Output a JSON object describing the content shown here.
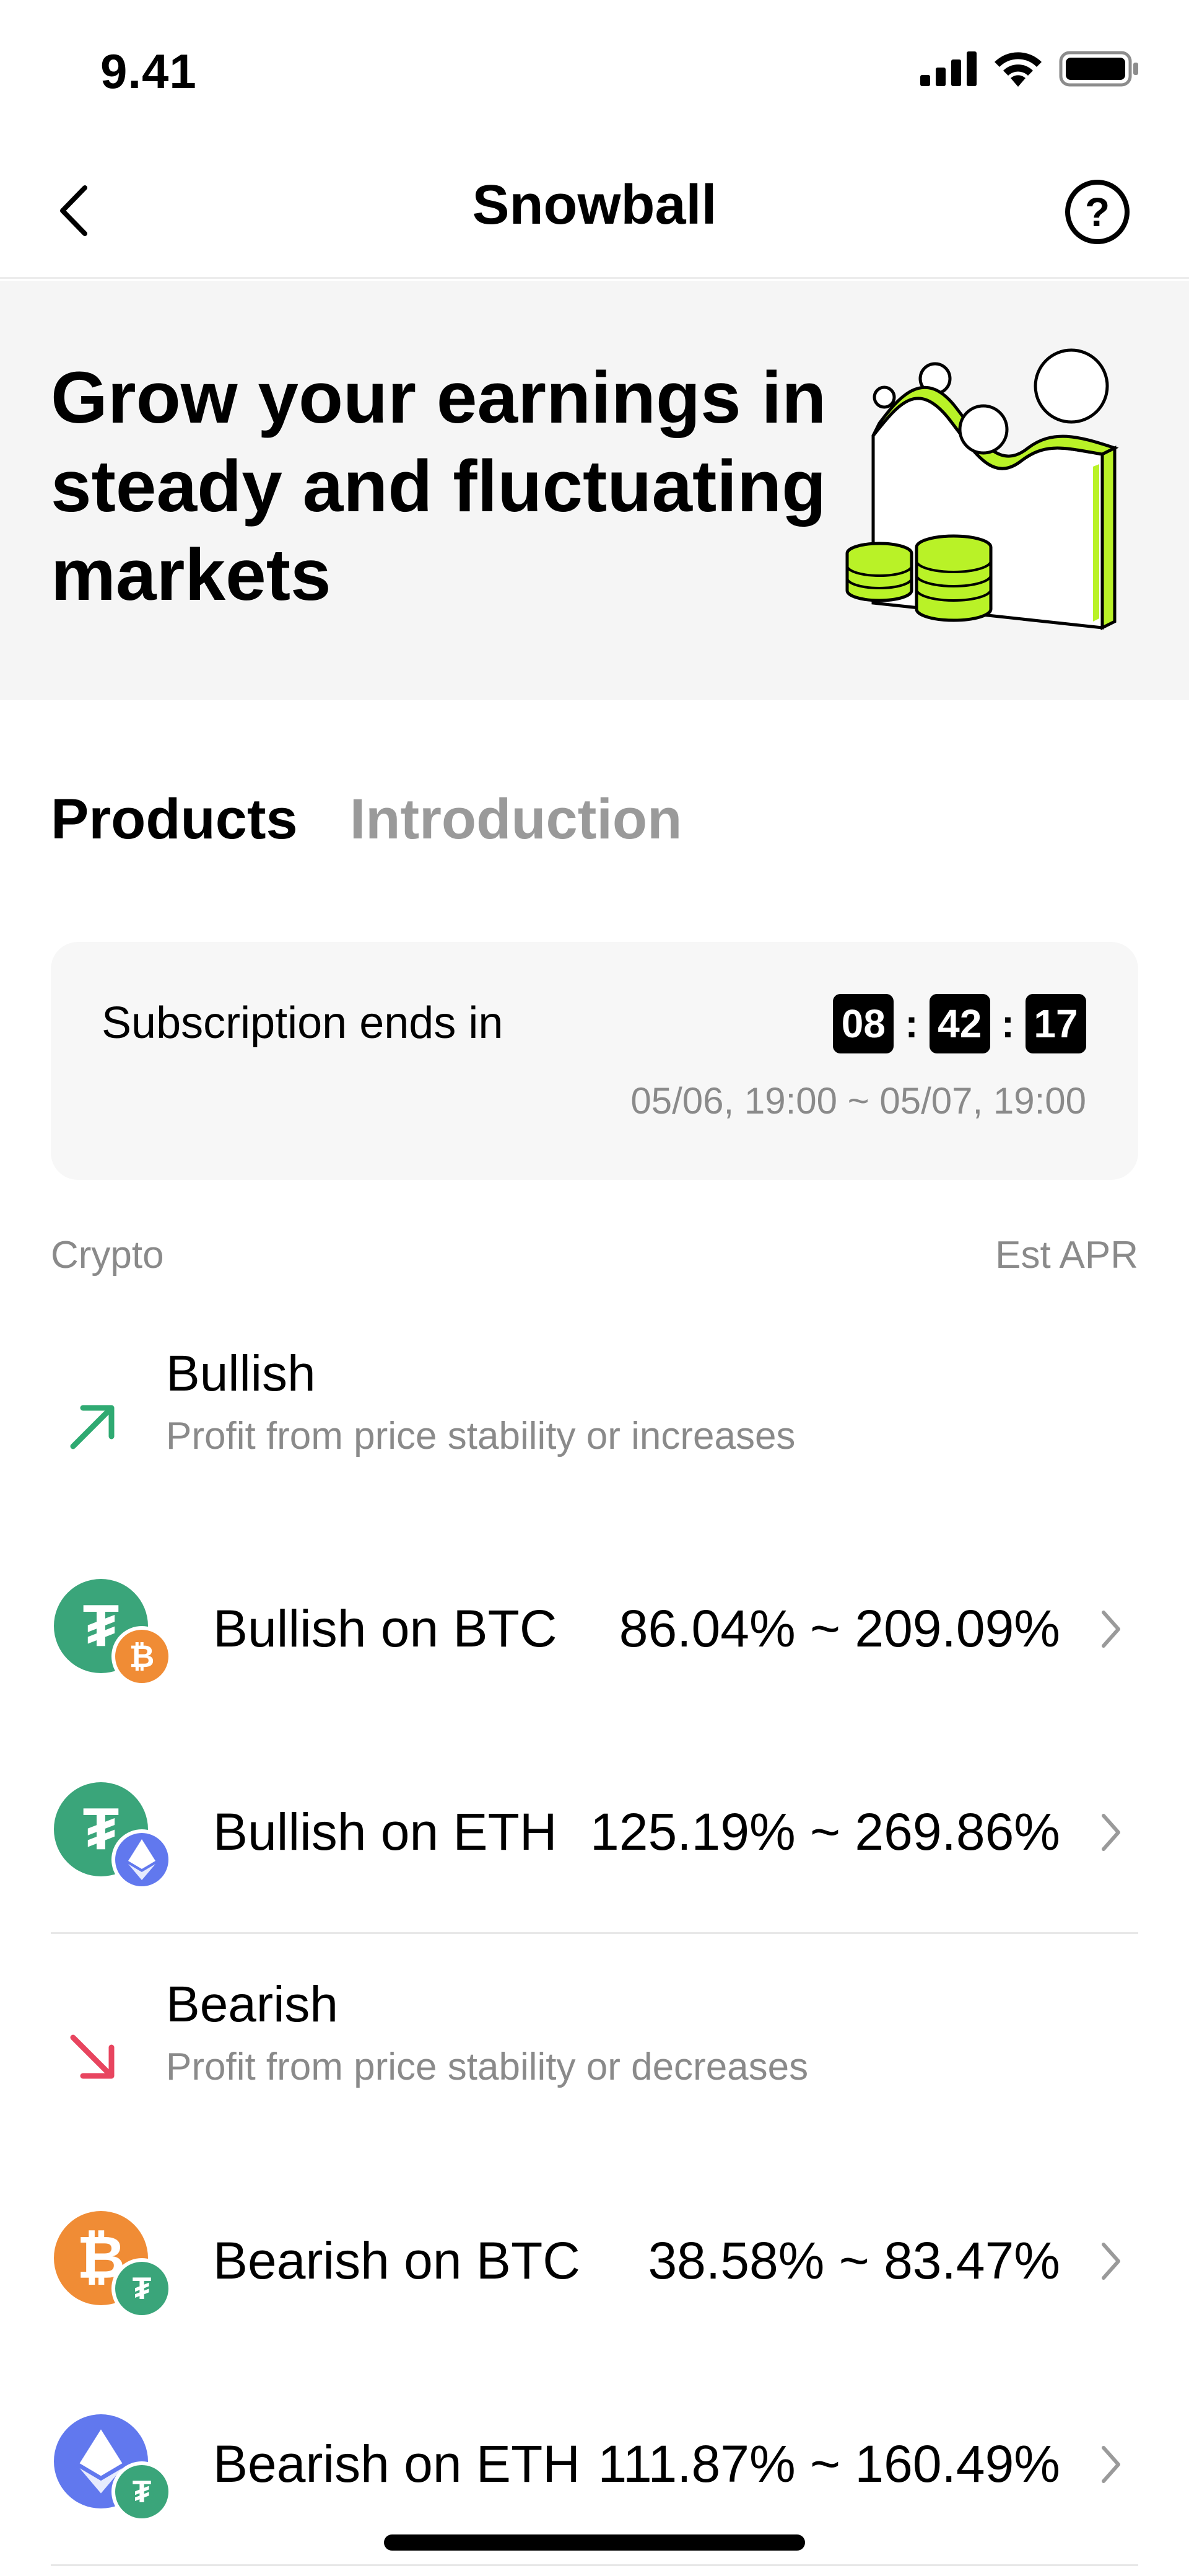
{
  "status_bar": {
    "time": "9.41"
  },
  "nav": {
    "title": "Snowball"
  },
  "hero": {
    "headline": "Grow your earnings in steady and fluctuating markets"
  },
  "tabs": [
    {
      "label": "Products",
      "active": true
    },
    {
      "label": "Introduction",
      "active": false
    }
  ],
  "subscription": {
    "label": "Subscription ends in",
    "hours": "08",
    "minutes": "42",
    "seconds": "17",
    "separator": ":",
    "range": "05/06, 19:00 ~ 05/07, 19:00"
  },
  "columns": {
    "left": "Crypto",
    "right": "Est APR"
  },
  "sections": [
    {
      "title": "Bullish",
      "description": "Profit from price stability or increases",
      "icon": "arrow-up-right-icon",
      "color": "#2faa72",
      "products": [
        {
          "name": "Bullish on BTC",
          "apr": "86.04% ~ 209.09%",
          "main_coin": "tether-icon",
          "sub_coin": "bitcoin-icon"
        },
        {
          "name": "Bullish on ETH",
          "apr": "125.19% ~ 269.86%",
          "main_coin": "tether-icon",
          "sub_coin": "ethereum-icon"
        }
      ]
    },
    {
      "title": "Bearish",
      "description": "Profit from price stability or decreases",
      "icon": "arrow-down-right-icon",
      "color": "#e8455f",
      "products": [
        {
          "name": "Bearish on BTC",
          "apr": "38.58% ~ 83.47%",
          "main_coin": "bitcoin-icon",
          "sub_coin": "tether-icon"
        },
        {
          "name": "Bearish on ETH",
          "apr": "111.87% ~ 160.49%",
          "main_coin": "ethereum-icon",
          "sub_coin": "tether-icon"
        }
      ]
    }
  ],
  "colors": {
    "accent_lime": "#b9f227",
    "tether": "#3aa57a",
    "bitcoin": "#f08c35",
    "ethereum": "#6178ee"
  },
  "glyphs": {
    "tether": "₮",
    "bitcoin": "₿"
  }
}
